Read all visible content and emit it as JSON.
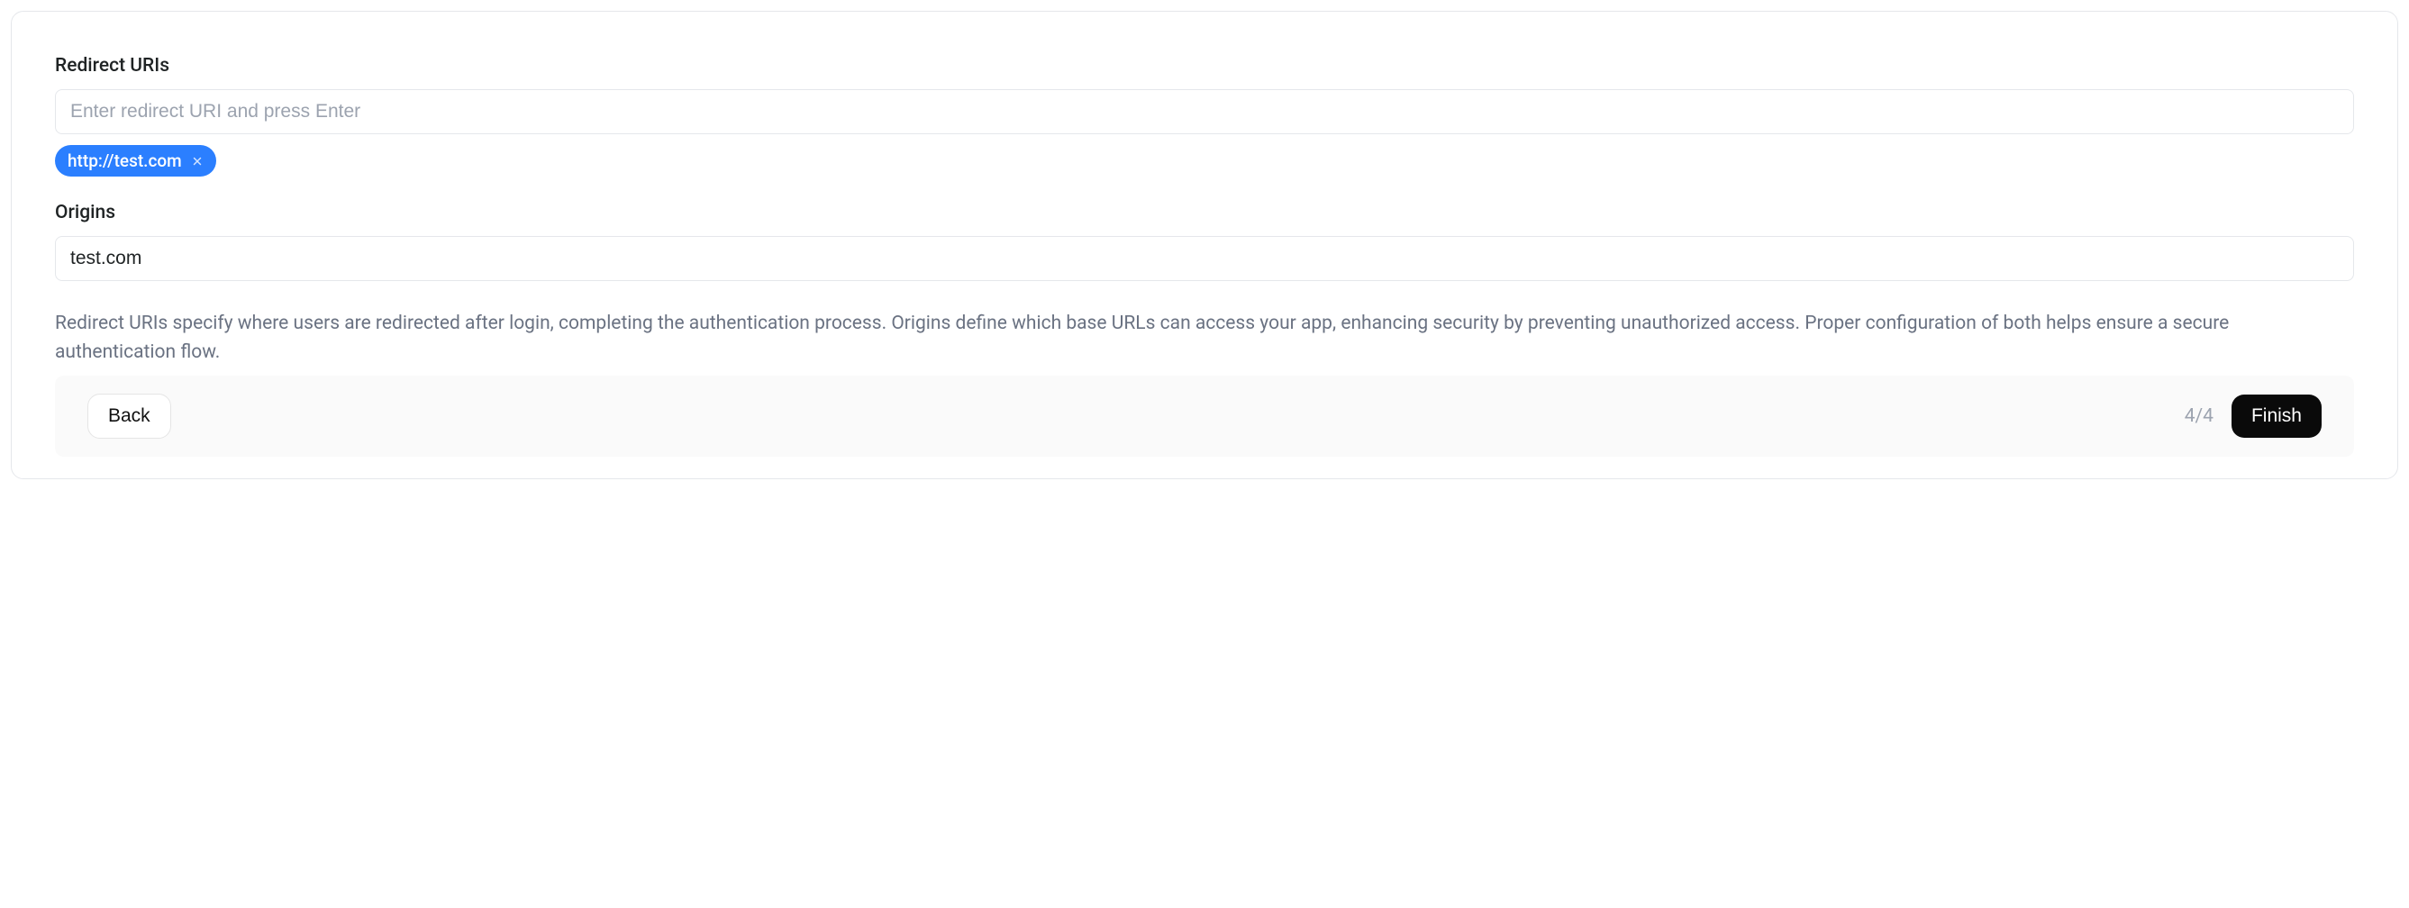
{
  "redirect": {
    "label": "Redirect URIs",
    "placeholder": "Enter redirect URI and press Enter",
    "chips": [
      "http://test.com"
    ]
  },
  "origins": {
    "label": "Origins",
    "value": "test.com"
  },
  "description": "Redirect URIs specify where users are redirected after login, completing the authentication process. Origins define which base URLs can access your app, enhancing security by preventing unauthorized access. Proper configuration of both helps ensure a secure authentication flow.",
  "footer": {
    "back_label": "Back",
    "step": "4/4",
    "finish_label": "Finish"
  }
}
